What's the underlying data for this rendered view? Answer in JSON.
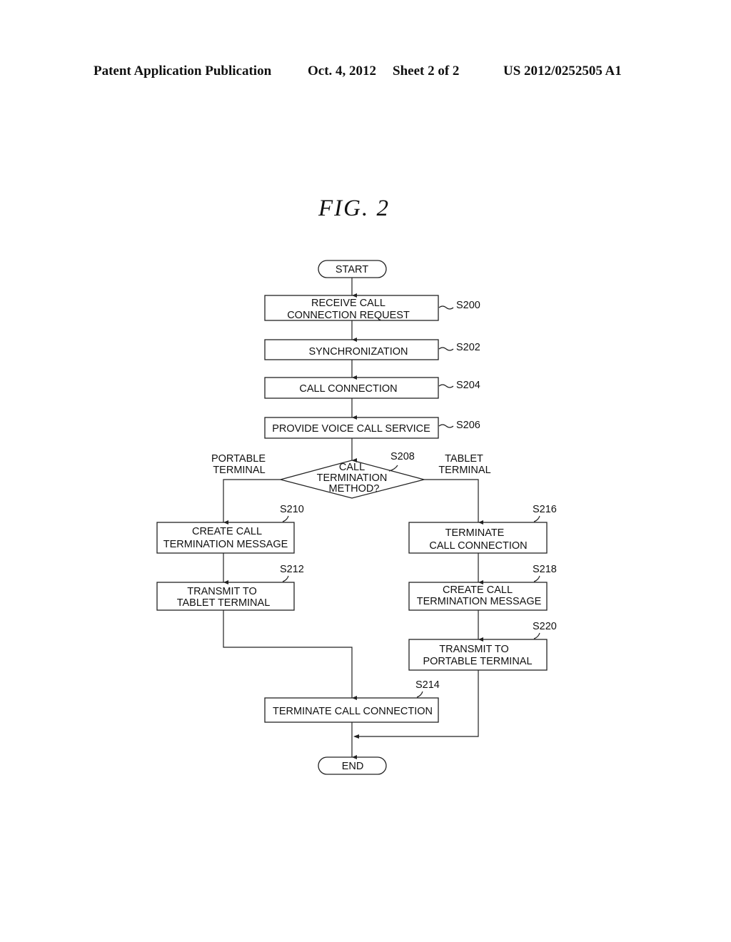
{
  "header": {
    "publication": "Patent Application Publication",
    "date": "Oct. 4, 2012",
    "sheet": "Sheet 2 of 2",
    "number": "US 2012/0252505 A1"
  },
  "figure_title": "FIG. 2",
  "flowchart": {
    "start": "START",
    "end": "END",
    "steps": [
      {
        "id": "S200",
        "lines": [
          "RECEIVE CALL",
          "CONNECTION REQUEST"
        ]
      },
      {
        "id": "S202",
        "lines": [
          "SYNCHRONIZATION"
        ]
      },
      {
        "id": "S204",
        "lines": [
          "CALL CONNECTION"
        ]
      },
      {
        "id": "S206",
        "lines": [
          "PROVIDE VOICE CALL SERVICE"
        ]
      },
      {
        "id": "S208",
        "lines": [
          "CALL",
          "TERMINATION",
          "METHOD?"
        ],
        "type": "decision"
      },
      {
        "id": "S210",
        "lines": [
          "CREATE CALL",
          "TERMINATION MESSAGE"
        ]
      },
      {
        "id": "S212",
        "lines": [
          "TRANSMIT TO",
          "TABLET TERMINAL"
        ]
      },
      {
        "id": "S216",
        "lines": [
          "TERMINATE",
          "CALL CONNECTION"
        ]
      },
      {
        "id": "S218",
        "lines": [
          "CREATE CALL",
          "TERMINATION MESSAGE"
        ]
      },
      {
        "id": "S220",
        "lines": [
          "TRANSMIT TO",
          "PORTABLE TERMINAL"
        ]
      },
      {
        "id": "S214",
        "lines": [
          "TERMINATE CALL CONNECTION"
        ]
      }
    ],
    "branches": {
      "left": [
        "PORTABLE",
        "TERMINAL"
      ],
      "right": [
        "TABLET",
        "TERMINAL"
      ]
    }
  }
}
